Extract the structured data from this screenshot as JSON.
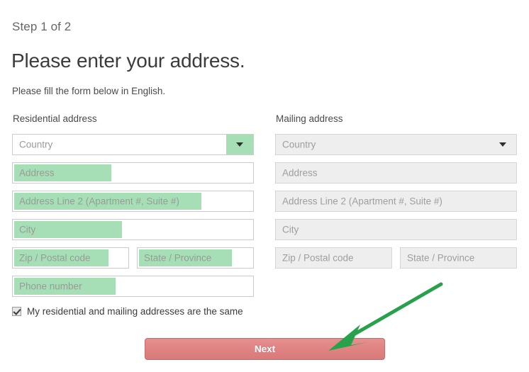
{
  "header": {
    "step": "Step 1 of 2",
    "title": "Please enter your address.",
    "subtitle": "Please fill the form below in English."
  },
  "residential": {
    "heading": "Residential address",
    "country": "Country",
    "address": "Address",
    "address2": "Address Line 2 (Apartment #, Suite #)",
    "city": "City",
    "zip": "Zip / Postal code",
    "state": "State / Province",
    "phone": "Phone number"
  },
  "mailing": {
    "heading": "Mailing address",
    "country": "Country",
    "address": "Address",
    "address2": "Address Line 2 (Apartment #, Suite #)",
    "city": "City",
    "zip": "Zip / Postal code",
    "state": "State / Province"
  },
  "same_address": {
    "label": "My residential and mailing addresses are the same",
    "checked": true
  },
  "actions": {
    "next": "Next"
  },
  "colors": {
    "highlight_green": "#a6dfb5",
    "arrow_green": "#27a14a",
    "button_red": "#e08484",
    "placeholder_gray": "#9a9a9a",
    "disabled_field": "#eeeeee"
  }
}
